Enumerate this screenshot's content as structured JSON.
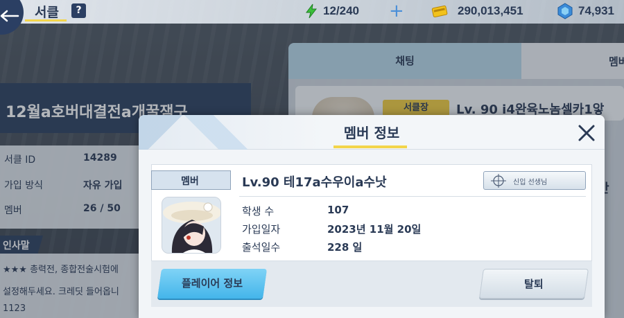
{
  "topbar": {
    "title": "서클",
    "help": "?",
    "stamina": "12/240",
    "credits": "290,013,451",
    "gems": "74,931"
  },
  "circle": {
    "name": "12월a호버대결전a개꿀잼구",
    "id_label": "서클 ID",
    "id_value": "14289",
    "join_label": "가입 방식",
    "join_value": "자유 가입",
    "member_label": "멤버",
    "member_value": "26 / 50",
    "greeting_tag": "인사말",
    "greeting_lines": [
      "★★★ 총력전, 종합전술시험에",
      "설정해두세요. 크레딧 들어옵니",
      "1123"
    ]
  },
  "right": {
    "tab_chat": "채팅",
    "tab_member": "멤버",
    "leader_badge": "서클장",
    "leader_name": "Lv. 90 i4완육노놈셀카1앟",
    "side_char": "안"
  },
  "modal": {
    "title": "멤버 정보",
    "member_tag": "멤버",
    "member_name": "Lv.90 테17a수우이a수낫",
    "title_badge": "신입 선생님",
    "students_label": "학생 수",
    "students_value": "107",
    "joined_label": "가입일자",
    "joined_value": "2023년 11월 20일",
    "attendance_label": "출석일수",
    "attendance_value": "228 일",
    "profile_button": "플레이어 정보",
    "leave_button": "탈퇴"
  },
  "colors": {
    "navy": "#2a3a55",
    "accent_yellow": "#f3d54a",
    "button_blue": "#44b5ea"
  }
}
